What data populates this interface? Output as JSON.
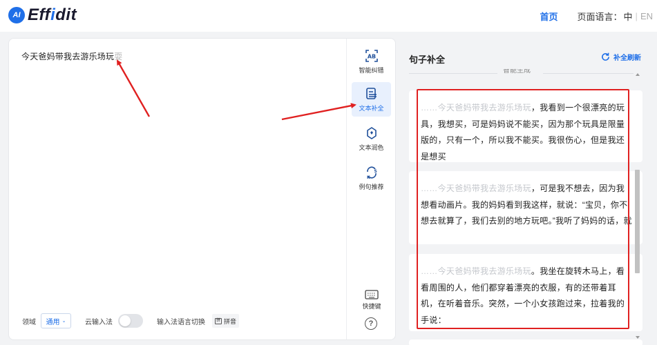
{
  "header": {
    "logo_badge": "AI",
    "logo_text_a": "Eff",
    "logo_text_b": "i",
    "logo_text_c": "dit",
    "nav_home": "首页",
    "lang_label": "页面语言：",
    "lang_zh": "中",
    "lang_sep": "|",
    "lang_en": "EN"
  },
  "editor": {
    "input_text": "今天爸妈带我去游乐场玩",
    "ghost_text": "耍",
    "tools": [
      {
        "label": "智能纠错",
        "icon": "ab-scan-icon"
      },
      {
        "label": "文本补全",
        "icon": "text-complete-icon"
      },
      {
        "label": "文本润色",
        "icon": "polish-icon"
      },
      {
        "label": "例句推荐",
        "icon": "sentence-recommend-icon"
      }
    ],
    "domain_label": "领域",
    "domain_value": "通用",
    "cloud_ime_label": "云输入法",
    "ime_switch_label": "输入法语言切换",
    "ime_button": "拼音",
    "shortcut_label": "快捷键",
    "help_symbol": "?"
  },
  "panel": {
    "title": "句子补全",
    "refresh_label": "补全刷新",
    "section_label": "智能生成",
    "cards": [
      {
        "prefix": "……今天爸妈带我去游乐场玩",
        "text": "，我看到一个很漂亮的玩具，我想买，可是妈妈说不能买，因为那个玩具是限量版的，只有一个，所以我不能买。我很伤心，但是我还是想买"
      },
      {
        "prefix": "……今天爸妈带我去游乐场玩",
        "text": "，可是我不想去，因为我想看动画片。我的妈妈看到我这样，就说：“宝贝，你不想去就算了，我们去别的地方玩吧。”我听了妈妈的话，就"
      },
      {
        "prefix": "……今天爸妈带我去游乐场玩",
        "text": "。我坐在旋转木马上，看看周围的人，他们都穿着漂亮的衣服，有的还带着耳机，在听着音乐。突然，一个小女孩跑过来，拉着我的手说："
      }
    ]
  },
  "colors": {
    "brand": "#1f6fe8",
    "highlight": "#e02020",
    "ghost": "#c4c7cc"
  }
}
